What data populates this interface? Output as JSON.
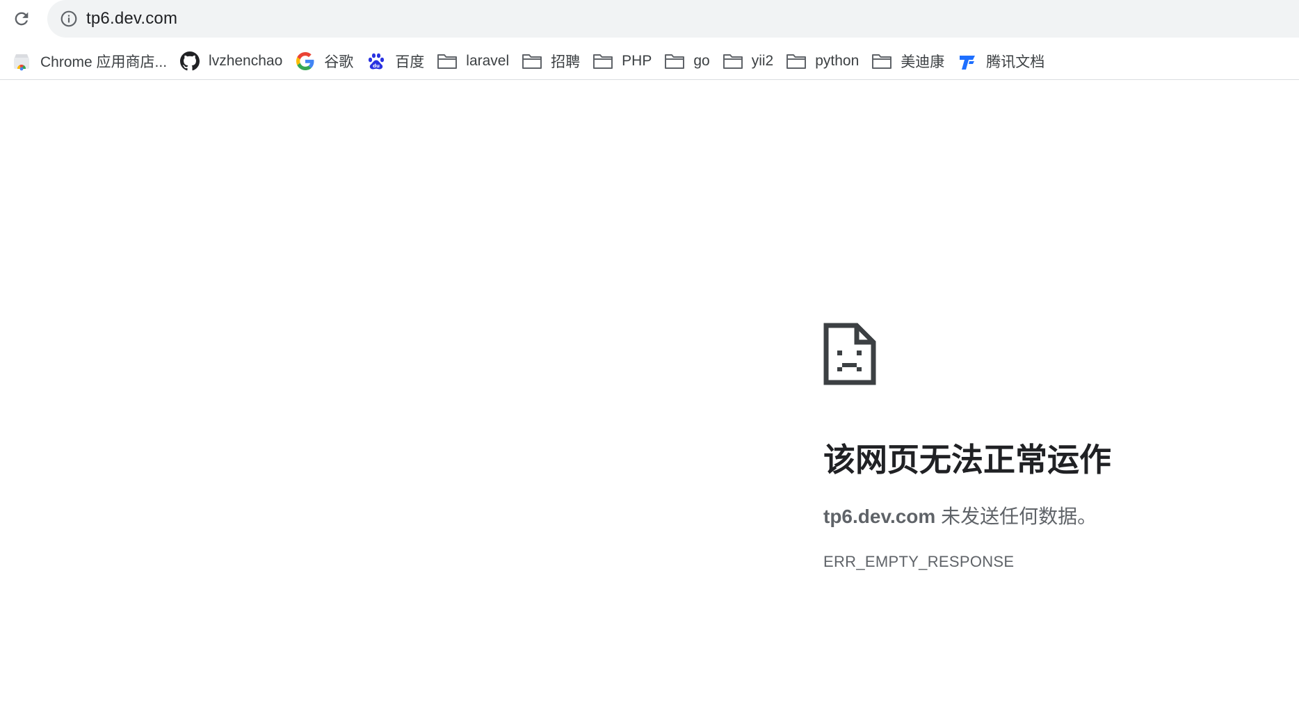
{
  "address_bar": {
    "url": "tp6.dev.com"
  },
  "bookmarks": [
    {
      "label": "Chrome 应用商店...",
      "icon": "chrome-web-store-icon"
    },
    {
      "label": "lvzhenchao",
      "icon": "github-icon"
    },
    {
      "label": "谷歌",
      "icon": "google-icon"
    },
    {
      "label": "百度",
      "icon": "baidu-icon"
    },
    {
      "label": "laravel",
      "icon": "folder-icon"
    },
    {
      "label": "招聘",
      "icon": "folder-icon"
    },
    {
      "label": "PHP",
      "icon": "folder-icon"
    },
    {
      "label": "go",
      "icon": "folder-icon"
    },
    {
      "label": "yii2",
      "icon": "folder-icon"
    },
    {
      "label": "python",
      "icon": "folder-icon"
    },
    {
      "label": "美迪康",
      "icon": "folder-icon"
    },
    {
      "label": "腾讯文档",
      "icon": "tencent-docs-icon"
    }
  ],
  "error": {
    "title": "该网页无法正常运作",
    "host": "tp6.dev.com",
    "message": " 未发送任何数据。",
    "code": "ERR_EMPTY_RESPONSE"
  },
  "colors": {
    "omnibox_bg": "#f1f3f4",
    "text_primary": "#202124",
    "text_secondary": "#5f6368",
    "folder_icon": "#5f6368",
    "baidu_blue": "#2932e1",
    "tencent_blue": "#1e6fff"
  }
}
